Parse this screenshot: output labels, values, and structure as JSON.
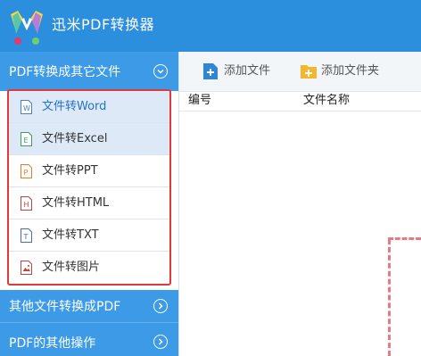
{
  "app": {
    "title": "迅米PDF转换器"
  },
  "sidebar": {
    "section1": {
      "label": "PDF转换成其它文件"
    },
    "items": [
      {
        "label": "文件转Word",
        "icon": "W"
      },
      {
        "label": "文件转Excel",
        "icon": "E"
      },
      {
        "label": "文件转PPT",
        "icon": "P"
      },
      {
        "label": "文件转HTML",
        "icon": "H"
      },
      {
        "label": "文件转TXT",
        "icon": "T"
      },
      {
        "label": "文件转图片",
        "icon": "img"
      }
    ],
    "section2": {
      "label": "其他文件转换成PDF"
    },
    "section3": {
      "label": "PDF的其他操作"
    }
  },
  "toolbar": {
    "add_file": "添加文件",
    "add_folder": "添加文件夹"
  },
  "table": {
    "col_id": "编号",
    "col_name": "文件名称"
  },
  "colors": {
    "header_blue": "#2b8fde",
    "section_blue": "#3c9ae6",
    "highlight": "#e23a3a"
  }
}
